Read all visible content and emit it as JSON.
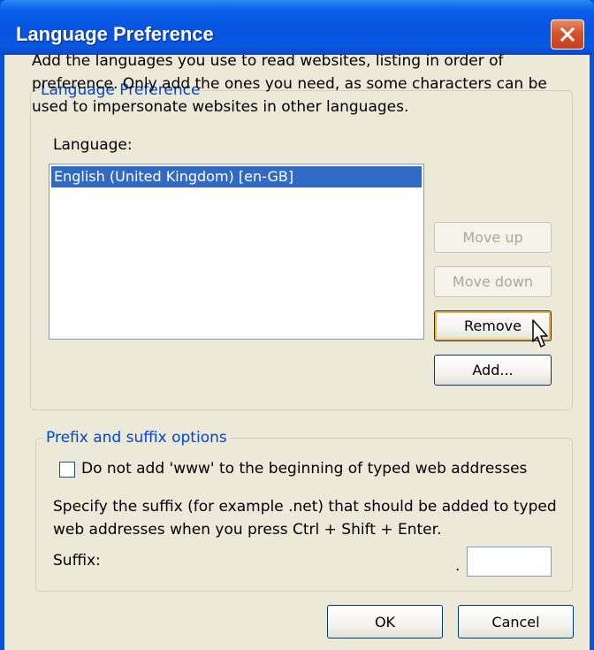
{
  "window": {
    "title": "Language Preference",
    "close_icon": "close-icon"
  },
  "language_group": {
    "legend": "Language Preference",
    "description": "Add the languages you use to read websites, listing in order of preference. Only add the ones you need, as some characters can be used to impersonate websites in other languages.",
    "list_label": "Language:",
    "languages": [
      "English (United Kingdom) [en-GB]"
    ],
    "selected_index": 0,
    "buttons": {
      "move_up": "Move up",
      "move_down": "Move down",
      "remove": "Remove",
      "add": "Add..."
    }
  },
  "prefix_group": {
    "legend": "Prefix and suffix options",
    "www_checkbox_label": "Do not add 'www' to the beginning of typed web addresses",
    "www_checked": false,
    "suffix_description": "Specify the suffix (for example .net) that should be added to typed web addresses when you press Ctrl + Shift + Enter.",
    "suffix_label": "Suffix:",
    "suffix_dot": ".",
    "suffix_value": ""
  },
  "footer": {
    "ok": "OK",
    "cancel": "Cancel"
  },
  "colors": {
    "titlebar": "#0654e0",
    "dialog_bg": "#ece9d8",
    "group_legend": "#0046d5",
    "selection": "#316ac5",
    "close_button": "#d7522a"
  }
}
